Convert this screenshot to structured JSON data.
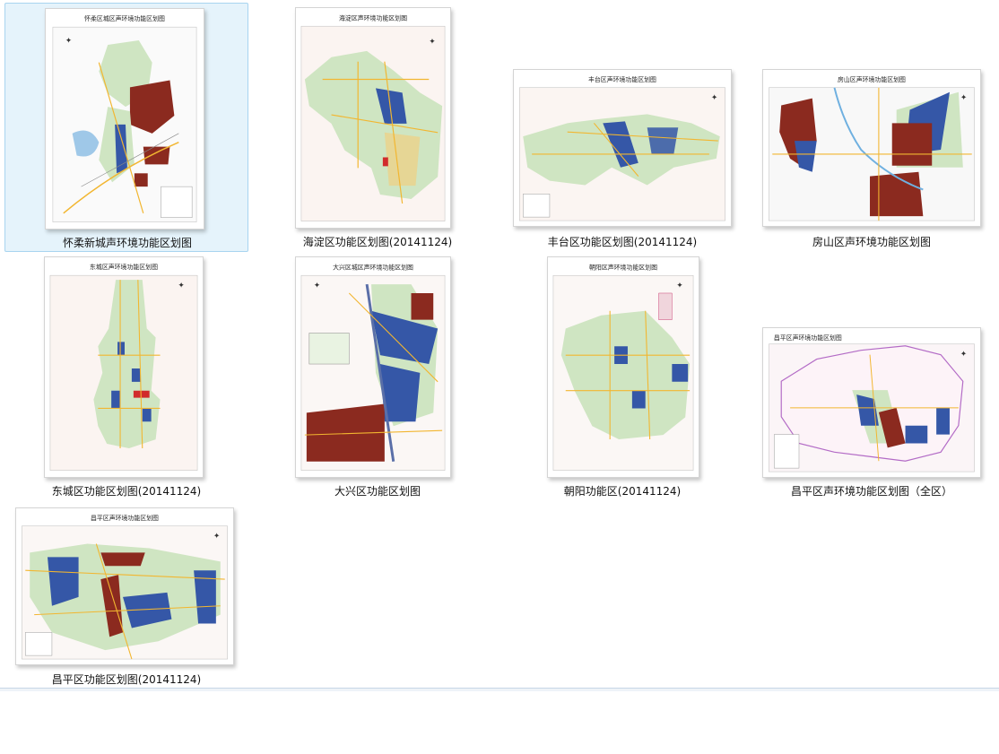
{
  "colors": {
    "accent_selection": "#cce8ff",
    "zone_brown": "#8b2a1f",
    "zone_blue": "#3557a7",
    "zone_green": "#cfe5c2",
    "road_yellow": "#f2b630"
  },
  "files": [
    {
      "caption": "怀柔新城声环境功能区划图",
      "map_title": "怀柔区城区声环境功能区划图",
      "selected": true
    },
    {
      "caption": "海淀区功能区划图(20141124)",
      "map_title": "海淀区声环境功能区划图",
      "selected": false
    },
    {
      "caption": "丰台区功能区划图(20141124)",
      "map_title": "丰台区声环境功能区划图",
      "selected": false
    },
    {
      "caption": "房山区声环境功能区划图",
      "map_title": "房山区声环境功能区划图",
      "selected": false
    },
    {
      "caption": "东城区功能区划图(20141124)",
      "map_title": "东城区声环境功能区划图",
      "selected": false
    },
    {
      "caption": "大兴区功能区划图",
      "map_title": "大兴区城区声环境功能区划图",
      "selected": false
    },
    {
      "caption": "朝阳功能区(20141124)",
      "map_title": "朝阳区声环境功能区划图",
      "selected": false
    },
    {
      "caption": "昌平区声环境功能区划图（全区）",
      "map_title": "昌平区声环境功能区划图",
      "selected": false
    },
    {
      "caption": "昌平区功能区划图(20141124)",
      "map_title": "昌平区声环境功能区划图",
      "selected": false
    }
  ]
}
